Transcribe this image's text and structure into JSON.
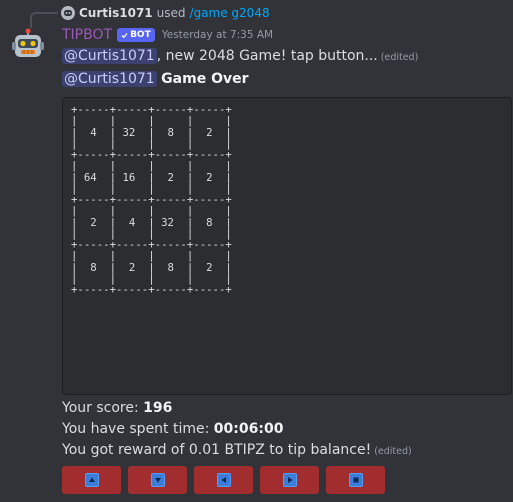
{
  "reply": {
    "username": "Curtis1071",
    "used_text": "used",
    "command": "/game g2048"
  },
  "message": {
    "author": "TIPBOT",
    "badge": "BOT",
    "timestamp": "Yesterday at 7:35 AM",
    "line1": {
      "mention": "@Curtis1071",
      "text": ", new 2048 Game! tap button...",
      "edited": "(edited)"
    },
    "line2": {
      "mention": "@Curtis1071",
      "text": "Game Over"
    },
    "board": [
      [
        4,
        32,
        8,
        2
      ],
      [
        64,
        16,
        2,
        2
      ],
      [
        2,
        4,
        32,
        8
      ],
      [
        8,
        2,
        8,
        2
      ]
    ],
    "score_label": "Your score:",
    "score_value": "196",
    "time_label": "You have spent time:",
    "time_value": "00:06:00",
    "reward_text": "You got reward of 0.01 BTIPZ to tip balance!",
    "reward_edited": "(edited)"
  },
  "buttons": [
    {
      "name": "up",
      "icon": "arrow-up-icon"
    },
    {
      "name": "down",
      "icon": "arrow-down-icon"
    },
    {
      "name": "left",
      "icon": "arrow-left-icon"
    },
    {
      "name": "right",
      "icon": "arrow-right-icon"
    },
    {
      "name": "stop",
      "icon": "stop-icon"
    }
  ],
  "colors": {
    "background": "#313338",
    "codeblock": "#2b2d31",
    "button": "#a12d2f",
    "button_icon": "#3b7dd8",
    "author": "#9b59b6",
    "link": "#00a8fc",
    "badge": "#5865f2"
  }
}
